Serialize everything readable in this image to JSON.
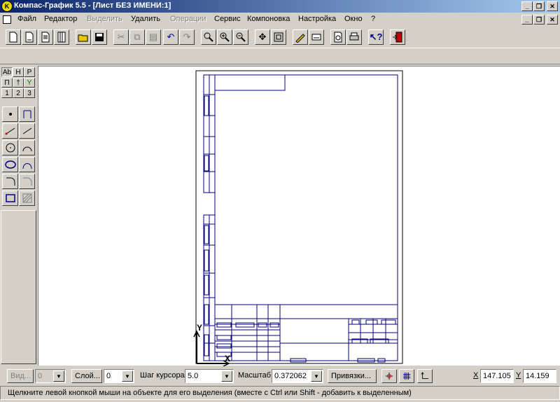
{
  "window": {
    "title": "Компас-График 5.5 - [Лист БЕЗ ИМЕНИ:1]",
    "controls": [
      "_",
      "❐",
      "✕"
    ]
  },
  "menu": {
    "items": [
      {
        "label": "Файл",
        "enabled": true
      },
      {
        "label": "Редактор",
        "enabled": true
      },
      {
        "label": "Выделить",
        "enabled": false
      },
      {
        "label": "Удалить",
        "enabled": true
      },
      {
        "label": "Операции",
        "enabled": false
      },
      {
        "label": "Сервис",
        "enabled": true
      },
      {
        "label": "Компоновка",
        "enabled": true
      },
      {
        "label": "Настройка",
        "enabled": true
      },
      {
        "label": "Окно",
        "enabled": true
      },
      {
        "label": "?",
        "enabled": true
      }
    ]
  },
  "toolbar": {
    "icons": [
      "new-document-icon",
      "new-sheet-icon",
      "new-text-icon",
      "new-spec-icon",
      "open-icon",
      "save-icon",
      "cut-icon",
      "copy-icon",
      "paste-icon",
      "undo-icon",
      "redo-icon",
      "zoom-window-icon",
      "zoom-in-icon",
      "zoom-out-icon",
      "pan-icon",
      "zoom-all-icon",
      "properties-icon",
      "layer-icon",
      "preview-icon",
      "print-icon",
      "help-icon",
      "exit-icon"
    ]
  },
  "left_panel": {
    "tab_row1": [
      "Ab",
      "H",
      "P"
    ],
    "tab_row2": [
      "П",
      "†",
      "Y"
    ],
    "tab_row3": [
      "1",
      "2",
      "3"
    ]
  },
  "status": {
    "view_label": "Вид...",
    "view_value": "0",
    "layer_label": "Слой...",
    "layer_value": "0",
    "step_label": "Шаг курсора",
    "step_value": "5.0",
    "scale_label": "Масштаб",
    "scale_value": "0.372062",
    "snaps_label": "Привязки...",
    "x_label": "X",
    "x_value": "147.105",
    "y_label": "Y",
    "y_value": "14.159",
    "message": "Щелкните левой кнопкой мыши на объекте для его выделения (вместе с Ctrl или Shift - добавить к выделенным)"
  },
  "drawing": {
    "axis_y": "Y",
    "axis_x": "X"
  }
}
